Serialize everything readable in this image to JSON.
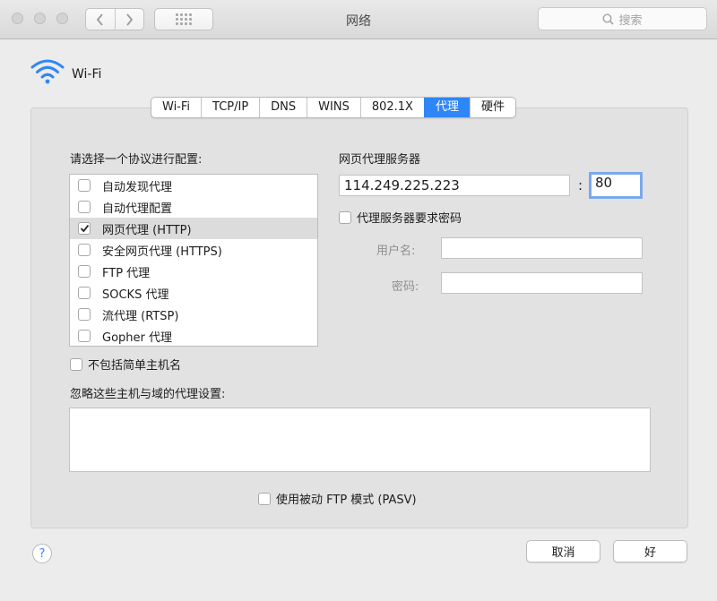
{
  "window": {
    "title": "网络"
  },
  "search": {
    "placeholder": "搜索"
  },
  "header": {
    "interface_name": "Wi-Fi"
  },
  "tabs": [
    "Wi-Fi",
    "TCP/IP",
    "DNS",
    "WINS",
    "802.1X",
    "代理",
    "硬件"
  ],
  "active_tab": "代理",
  "protocols": {
    "heading": "请选择一个协议进行配置:",
    "items": [
      {
        "label": "自动发现代理",
        "checked": false
      },
      {
        "label": "自动代理配置",
        "checked": false
      },
      {
        "label": "网页代理 (HTTP)",
        "checked": true
      },
      {
        "label": "安全网页代理 (HTTPS)",
        "checked": false
      },
      {
        "label": "FTP 代理",
        "checked": false
      },
      {
        "label": "SOCKS 代理",
        "checked": false
      },
      {
        "label": "流代理 (RTSP)",
        "checked": false
      },
      {
        "label": "Gopher 代理",
        "checked": false
      }
    ]
  },
  "proxy_server": {
    "heading": "网页代理服务器",
    "address": "114.249.225.223",
    "separator": ":",
    "port": "80",
    "requires_password_label": "代理服务器要求密码",
    "requires_password": false,
    "username_label": "用户名:",
    "username": "",
    "password_label": "密码:",
    "password": ""
  },
  "exclude_simple_hosts_label": "不包括简单主机名",
  "bypass": {
    "heading": "忽略这些主机与域的代理设置:",
    "value": ""
  },
  "passive_ftp_label": "使用被动 FTP 模式 (PASV)",
  "buttons": {
    "help": "?",
    "cancel": "取消",
    "ok": "好"
  },
  "colors": {
    "accent": "#2f86f6",
    "focus_ring": "#7aa9ec"
  }
}
